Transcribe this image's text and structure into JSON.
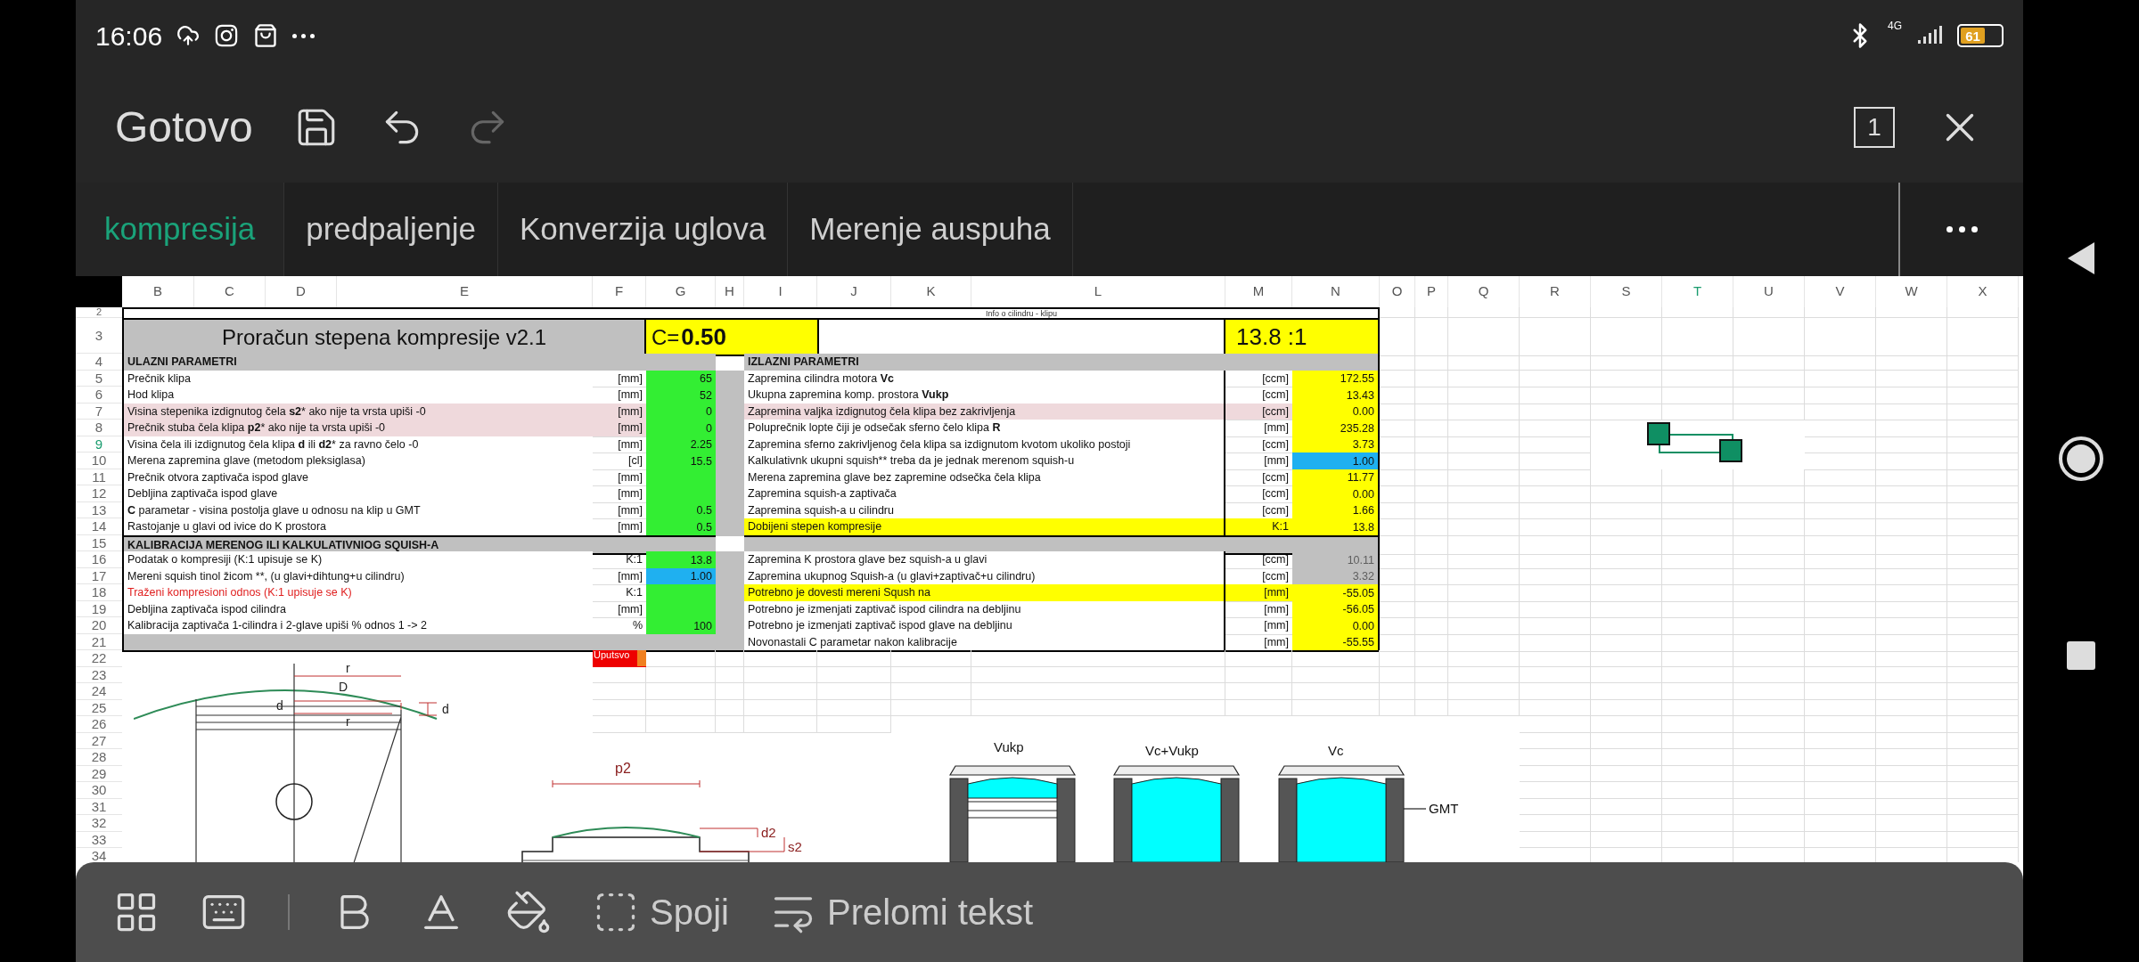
{
  "status_bar": {
    "time": "16:06",
    "network": "4G",
    "battery": "61"
  },
  "toolbar": {
    "done": "Gotovo",
    "redo_disabled": true,
    "sheet_count": "1"
  },
  "tabs": [
    {
      "label": "kompresija",
      "selected": true
    },
    {
      "label": "predpaljenje",
      "selected": false
    },
    {
      "label": "Konverzija uglova",
      "selected": false
    },
    {
      "label": "Merenje auspuha",
      "selected": false
    }
  ],
  "sheet": {
    "columns": [
      {
        "label": "B",
        "selected": false
      },
      {
        "label": "C",
        "selected": false
      },
      {
        "label": "D",
        "selected": false
      },
      {
        "label": "E",
        "selected": false
      },
      {
        "label": "F",
        "selected": false
      },
      {
        "label": "G",
        "selected": false
      },
      {
        "label": "H",
        "selected": false
      },
      {
        "label": "I",
        "selected": false
      },
      {
        "label": "J",
        "selected": false
      },
      {
        "label": "K",
        "selected": false
      },
      {
        "label": "L",
        "selected": false
      },
      {
        "label": "M",
        "selected": false
      },
      {
        "label": "N",
        "selected": false
      },
      {
        "label": "O",
        "selected": false
      },
      {
        "label": "P",
        "selected": false
      },
      {
        "label": "Q",
        "selected": false
      },
      {
        "label": "R",
        "selected": false
      },
      {
        "label": "S",
        "selected": false
      },
      {
        "label": "T",
        "selected": true
      },
      {
        "label": "U",
        "selected": false
      },
      {
        "label": "V",
        "selected": false
      },
      {
        "label": "W",
        "selected": false
      },
      {
        "label": "X",
        "selected": false
      }
    ],
    "rows": [
      {
        "label": "2",
        "selected": false
      },
      {
        "label": "3",
        "selected": false
      },
      {
        "label": "4",
        "selected": false
      },
      {
        "label": "5",
        "selected": false
      },
      {
        "label": "6",
        "selected": false
      },
      {
        "label": "7",
        "selected": false
      },
      {
        "label": "8",
        "selected": false
      },
      {
        "label": "9",
        "selected": true
      },
      {
        "label": "10",
        "selected": false
      },
      {
        "label": "11",
        "selected": false
      },
      {
        "label": "12",
        "selected": false
      },
      {
        "label": "13",
        "selected": false
      },
      {
        "label": "14",
        "selected": false
      },
      {
        "label": "15",
        "selected": false
      },
      {
        "label": "16",
        "selected": false
      },
      {
        "label": "17",
        "selected": false
      },
      {
        "label": "18",
        "selected": false
      },
      {
        "label": "19",
        "selected": false
      },
      {
        "label": "20",
        "selected": false
      },
      {
        "label": "21",
        "selected": false
      },
      {
        "label": "22",
        "selected": false
      },
      {
        "label": "23",
        "selected": false
      },
      {
        "label": "24",
        "selected": false
      },
      {
        "label": "25",
        "selected": false
      },
      {
        "label": "26",
        "selected": false
      },
      {
        "label": "27",
        "selected": false
      },
      {
        "label": "28",
        "selected": false
      },
      {
        "label": "29",
        "selected": false
      },
      {
        "label": "30",
        "selected": false
      },
      {
        "label": "31",
        "selected": false
      },
      {
        "label": "32",
        "selected": false
      },
      {
        "label": "33",
        "selected": false
      },
      {
        "label": "34",
        "selected": false
      }
    ],
    "info_note": "Info o cilindru - klipu",
    "title": "Proračun stepena kompresije v2.1",
    "c_label": "C=",
    "c_value": "0.50",
    "ratio": "13.8 :1",
    "table_rows": [
      {
        "left": {
          "kind": "header",
          "text": "ULAZNI PARAMETRI"
        },
        "right": {
          "kind": "header",
          "text": "IZLAZNI PARAMETRI"
        }
      },
      {
        "left": {
          "kind": "plain",
          "label": "Prečnik klipa",
          "unit": "[mm]",
          "value": "65",
          "color": "#33ee33"
        },
        "right": {
          "kind": "plain",
          "label": "Zapremina cilindra motora **Vc**",
          "unit": "[ccm]",
          "value": "172.55",
          "color": "#ffff00",
          "muted": false
        }
      },
      {
        "left": {
          "kind": "plain",
          "label": "Hod klipa",
          "unit": "[mm]",
          "value": "52",
          "color": "#33ee33"
        },
        "right": {
          "kind": "plain",
          "label": "Ukupna zapremina komp. prostora **Vukp**",
          "unit": "[ccm]",
          "value": "13.43",
          "color": "#ffff00",
          "muted": false
        }
      },
      {
        "left": {
          "kind": "pink",
          "label": "Visina stepenika izdignutog čela **s2*** ako nije ta vrsta upiši -0",
          "unit": "[mm]",
          "value": "0",
          "color": "#33ee33"
        },
        "right": {
          "kind": "pink",
          "label": "Zapremina valjka izdignutog čela klipa bez zakrivljenja",
          "unit": "[ccm]",
          "value": "0.00",
          "color": "#ffff00",
          "muted": false
        }
      },
      {
        "left": {
          "kind": "pink",
          "label": "Prečnik stuba čela klipa **p2*** ako nije ta vrsta upiši -0",
          "unit": "[mm]",
          "value": "0",
          "color": "#33ee33"
        },
        "right": {
          "kind": "plain",
          "label": "Poluprečnik lopte čiji je odsečak sferno čelo klipa **R**",
          "unit": "[mm]",
          "value": "235.28",
          "color": "#ffff00",
          "muted": false
        }
      },
      {
        "left": {
          "kind": "plain",
          "label": "Visina čela ili izdignutog čela klipa **d** ili **d2*** za ravno čelo -0",
          "unit": "[mm]",
          "value": "2.25",
          "color": "#33ee33"
        },
        "right": {
          "kind": "plain",
          "label": "Zapremina sferno zakrivljenog čela klipa sa izdignutom kvotom ukoliko postoji",
          "unit": "[ccm]",
          "value": "3.73",
          "color": "#ffff00",
          "muted": false
        }
      },
      {
        "left": {
          "kind": "plain",
          "label": "Merena zapremina glave (metodom pleksiglasa)",
          "unit": "[cl]",
          "value": "15.5",
          "color": "#33ee33"
        },
        "right": {
          "kind": "plain",
          "label": "Kalkulativnk ukupni squish**  treba da je jednak merenom squish-u",
          "unit": "[mm]",
          "value": "1.00",
          "color": "#1fb0f0",
          "muted": false
        }
      },
      {
        "left": {
          "kind": "plain",
          "label": "Prečnik otvora zaptivača ispod glave",
          "unit": "[mm]",
          "color": "#33ee33"
        },
        "right": {
          "kind": "plain",
          "label": "Merena zapremina glave bez zapremine odsečka čela klipa",
          "unit": "[ccm]",
          "value": "11.77",
          "color": "#ffff00",
          "muted": false
        }
      },
      {
        "left": {
          "kind": "plain",
          "label": "Debljina zaptivača ispod glave",
          "unit": "[mm]",
          "color": "#33ee33"
        },
        "right": {
          "kind": "plain",
          "label": "Zapremina squish-a zaptivača",
          "unit": "[ccm]",
          "value": "0.00",
          "color": "#ffff00",
          "muted": false
        }
      },
      {
        "left": {
          "kind": "plain",
          "label": "**C** parametar - visina postolja glave u odnosu na klip u GMT",
          "unit": "[mm]",
          "value": "0.5",
          "color": "#33ee33"
        },
        "right": {
          "kind": "plain",
          "label": "Zapremina squish-a u cilindru",
          "unit": "[ccm]",
          "value": "1.66",
          "color": "#ffff00",
          "muted": false
        }
      },
      {
        "left": {
          "kind": "plain",
          "label": "Rastojanje u glavi od ivice do K prostora",
          "unit": "[mm]",
          "value": "0.5",
          "color": "#33ee33"
        },
        "right": {
          "kind": "yellow",
          "label": "Dobijeni stepen kompresije",
          "unit": "K:1",
          "value": "13.8",
          "color": "#ffff00",
          "muted": false
        }
      },
      {
        "left": {
          "kind": "header",
          "text": "KALIBRACIJA MERENOG ILI KALKULATIVNIOG SQUISH-A"
        },
        "right": {
          "kind": "blank"
        }
      },
      {
        "left": {
          "kind": "plain",
          "label": "Podatak o kompresiji (K:1 upisuje se K)",
          "unit": "K:1",
          "value": "13.8",
          "color": "#33ee33"
        },
        "right": {
          "kind": "plain",
          "label": "Zapremina K prostora glave bez squish-a u glavi",
          "unit": "[ccm]",
          "value": "10.11",
          "color": "#c0c0c0",
          "muted": true
        }
      },
      {
        "left": {
          "kind": "plain",
          "label": "Mereni squish tinol žicom **, (u glavi+dihtung+u cilindru)",
          "unit": "[mm]",
          "value": "1.00",
          "color": "#1fb0f0"
        },
        "right": {
          "kind": "plain",
          "label": "Zapremina ukupnog Squish-a (u glavi+zaptivač+u cilindru)",
          "unit": "[ccm]",
          "value": "3.32",
          "color": "#c0c0c0",
          "muted": true
        }
      },
      {
        "left": {
          "kind": "red",
          "label": "Traženi kompresioni odnos (K:1 upisuje se K)",
          "unit": "K:1",
          "color": "#33ee33"
        },
        "right": {
          "kind": "yellow",
          "label": "Potrebno je dovesti mereni Sqush na",
          "unit": "[mm]",
          "value": "-55.05",
          "color": "#ffff00",
          "muted": false
        }
      },
      {
        "left": {
          "kind": "plain",
          "label": "Debljina zaptivača ispod cilindra",
          "unit": "[mm]",
          "color": "#33ee33"
        },
        "right": {
          "kind": "plain",
          "label": "Potrebno je izmenjati zaptivač ispod cilindra na debljinu",
          "unit": "[mm]",
          "value": "-56.05",
          "color": "#ffff00",
          "muted": false
        }
      },
      {
        "left": {
          "kind": "plain",
          "label": "Kalibracija zaptivača 1-cilindra i 2-glave upiši % odnos 1 -> 2",
          "unit": "%",
          "value": "100",
          "color": "#33ee33"
        },
        "right": {
          "kind": "plain",
          "label": "Potrebno je izmenjati zaptivač ispod glave na debljinu",
          "unit": "[mm]",
          "value": "0.00",
          "color": "#ffff00",
          "muted": false
        }
      },
      {
        "left": {
          "kind": "blank"
        },
        "right": {
          "kind": "plain",
          "label": "Novonastali C parametar nakon kalibracije",
          "unit": "[mm]",
          "value": "-55.55",
          "color": "#ffff00",
          "muted": false
        }
      }
    ],
    "help_button": "Uputsvo",
    "piston_labels": [
      "r",
      "D",
      "d",
      "r",
      "d"
    ],
    "step_labels": [
      "p2",
      "d2",
      "s2"
    ],
    "cylinder_labels": [
      "Vukp",
      "Vc+Vukp",
      "Vc",
      "GMT"
    ]
  },
  "bottom_toolbar": {
    "merge": "Spoji",
    "wrap": "Prelomi tekst"
  }
}
